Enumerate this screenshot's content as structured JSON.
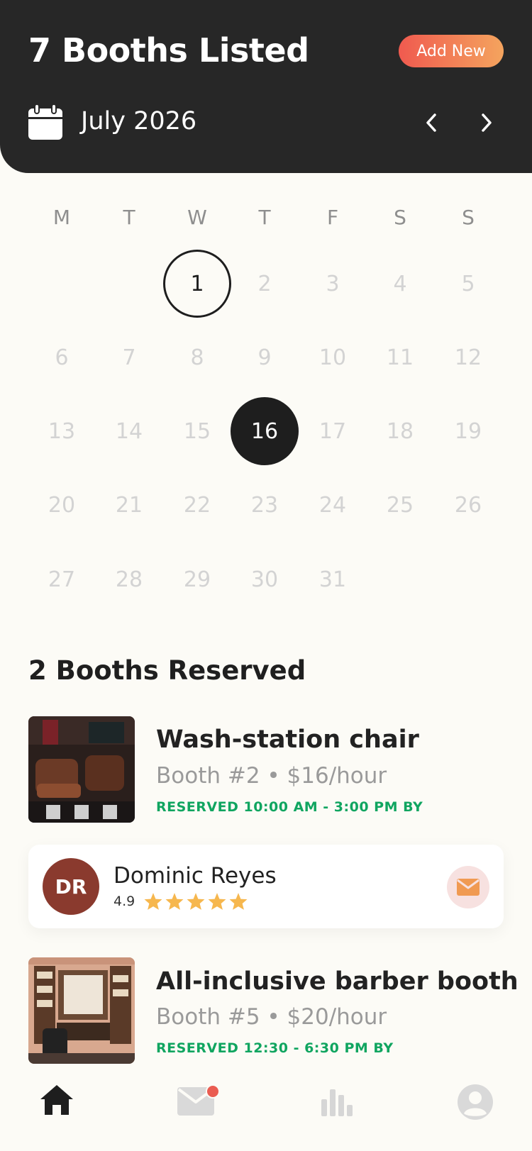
{
  "header": {
    "title": "7 Booths Listed",
    "add_label": "Add New",
    "month": "July 2026"
  },
  "calendar": {
    "weekdays": [
      "M",
      "T",
      "W",
      "T",
      "F",
      "S",
      "S"
    ],
    "days": [
      "1",
      "2",
      "3",
      "4",
      "5",
      "6",
      "7",
      "8",
      "9",
      "10",
      "11",
      "12",
      "13",
      "14",
      "15",
      "16",
      "17",
      "18",
      "19",
      "20",
      "21",
      "22",
      "23",
      "24",
      "25",
      "26",
      "27",
      "28",
      "29",
      "30",
      "31"
    ],
    "first_day": "1",
    "selected_day": "16"
  },
  "reserved": {
    "title": "2 Booths Reserved",
    "booths": [
      {
        "name": "Wash-station chair",
        "meta": "Booth #2 • $16/hour",
        "status": "RESERVED 10:00 AM - 3:00 PM BY"
      },
      {
        "name": "All-inclusive barber booth",
        "meta": "Booth #5 • $20/hour",
        "status": "RESERVED 12:30 - 6:30 PM BY"
      }
    ],
    "renter": {
      "initials": "DR",
      "name": "Dominic Reyes",
      "rating": "4.9",
      "stars": 5
    }
  },
  "nav": {
    "items": [
      "home-icon",
      "mail-icon",
      "stats-icon",
      "profile-icon"
    ],
    "active": "home-icon"
  },
  "colors": {
    "header_bg": "#272727",
    "accent_start": "#f05a4f",
    "accent_end": "#f4a45e",
    "status_green": "#10a560",
    "star": "#f6b74e"
  }
}
